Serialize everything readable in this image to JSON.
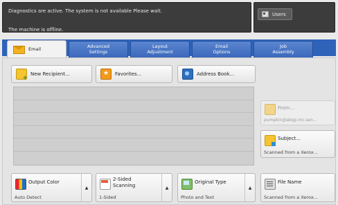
{
  "status": {
    "message_line1": "Diagnostics are active. The system is not available Please wait.",
    "message_line2": "The machine is offline."
  },
  "user_button": {
    "label": "Users",
    "icon": "user-icon"
  },
  "tabs": [
    {
      "label": "Email",
      "active": true
    },
    {
      "label": "Advanced\nSettings"
    },
    {
      "label": "Layout\nAdjustment"
    },
    {
      "label": "Email\nOptions"
    },
    {
      "label": "Job\nAssembly"
    }
  ],
  "toolbar": {
    "new_recipient": "New Recipient...",
    "favorites": "Favorites...",
    "address_book": "Address Book..."
  },
  "from": {
    "label": "From...",
    "value": "pumpkin@abqp.mc.sen..."
  },
  "subject": {
    "label": "Subject...",
    "value": "Scanned from a Xerox..."
  },
  "features": [
    {
      "label": "Output Color",
      "value": "Auto Detect",
      "icon": "output-color-icon"
    },
    {
      "label": "2-Sided\nScanning",
      "value": "1-Sided",
      "icon": "two-sided-icon"
    },
    {
      "label": "Original Type",
      "value": "Photo and Text",
      "icon": "original-type-icon"
    },
    {
      "label": "File Name",
      "value": "Scanned from a Xerox...",
      "icon": "file-name-icon"
    }
  ]
}
